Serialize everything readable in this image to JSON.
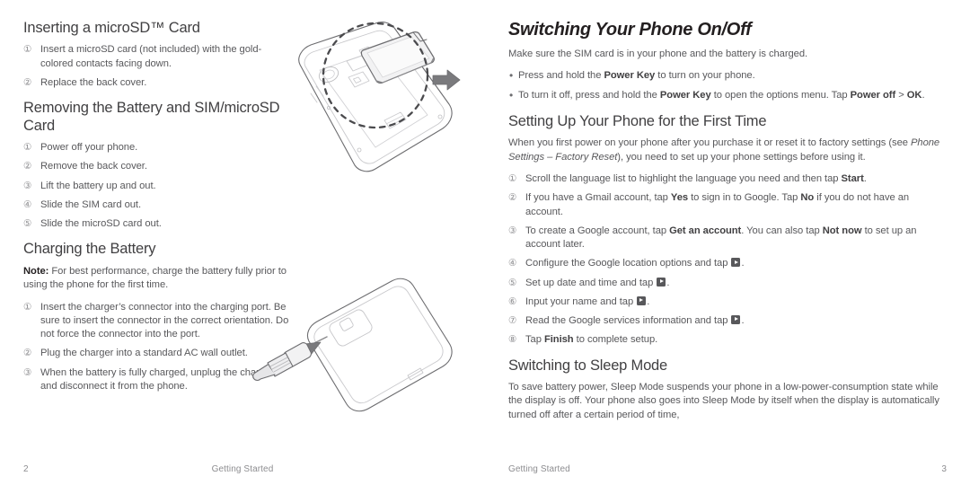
{
  "document": {
    "type": "phone-user-manual-spread",
    "colors": {
      "body_text": "#58585b",
      "heading_text": "#414042",
      "bold_text": "#231f20",
      "footer_text": "#8d8d90",
      "line_art": "#6d6d70",
      "background": "#ffffff"
    }
  },
  "left_page": {
    "sections": [
      {
        "heading": "Inserting a microSD™ Card",
        "steps": [
          "Insert a microSD card (not included) with the gold-colored contacts facing down.",
          "Replace the back cover."
        ]
      },
      {
        "heading": "Removing the Battery and SIM/microSD Card",
        "steps": [
          "Power off your phone.",
          "Remove the back cover.",
          "Lift the battery up and out.",
          "Slide the SIM card out.",
          "Slide the microSD card out."
        ]
      },
      {
        "heading": "Charging the Battery",
        "note_label": "Note:",
        "note_text": " For best performance, charge the battery fully prior to using the phone for the first time.",
        "steps": [
          "Insert the charger’s connector into the charging port. Be sure to insert the connector in the correct orientation. Do not force the connector into the port.",
          "Plug the charger into a standard AC wall outlet.",
          "When the battery is fully charged, unplug the charger and disconnect it from the phone."
        ]
      }
    ],
    "illustrations": [
      {
        "name": "phone-back-with-microsd-card",
        "caption_visible": false
      },
      {
        "name": "phone-with-charger-connector",
        "caption_visible": false
      }
    ],
    "footer": {
      "page_number": "2",
      "label": "Getting Started"
    }
  },
  "right_page": {
    "chapter_title": "Switching Your Phone On/Off",
    "intro": "Make sure the SIM card is in your phone and the battery is charged.",
    "bullets": [
      {
        "pre": "Press and hold the ",
        "bold": "Power Key",
        "post": " to turn on your phone."
      },
      {
        "pre": "To turn it off, press and hold the ",
        "bold": "Power Key",
        "post": " to open the options menu. Tap ",
        "bold2": "Power off",
        "mid2": " > ",
        "bold3": "OK",
        "post2": "."
      }
    ],
    "setup_section": {
      "heading": "Setting Up Your Phone for the First Time",
      "intro_pre": "When you first power on your phone after you purchase it or reset it to factory settings (see ",
      "intro_italic": "Phone Settings – Factory Reset",
      "intro_post": "), you need to set up your phone settings before using it.",
      "steps": [
        {
          "pre": "Scroll the language list to highlight the language you need and then tap ",
          "bold": "Start",
          "post": "."
        },
        {
          "pre": "If you have a Gmail account, tap ",
          "bold": "Yes",
          "mid": " to sign in to Google. Tap ",
          "bold2": "No",
          "post": " if you do not have an account."
        },
        {
          "pre": "To create a Google account, tap ",
          "bold": "Get an account",
          "mid": ". You can also tap ",
          "bold2": "Not now",
          "post": " to set up an account later."
        },
        {
          "pre": "Configure the Google location options and tap ",
          "icon": "next-play-button",
          "post": "."
        },
        {
          "pre": "Set up date and time and tap ",
          "icon": "next-play-button",
          "post": "."
        },
        {
          "pre": "Input your name and tap ",
          "icon": "next-play-button",
          "post": "."
        },
        {
          "pre": "Read the Google services information and tap ",
          "icon": "next-play-button",
          "post": "."
        },
        {
          "pre": "Tap ",
          "bold": "Finish",
          "post": " to complete setup."
        }
      ]
    },
    "sleep_section": {
      "heading": "Switching to Sleep Mode",
      "text": "To save battery power, Sleep Mode suspends your phone in a low-power-consumption state while the display is off. Your phone also goes into Sleep Mode by itself when the display is automatically turned off after a certain period of time,"
    },
    "footer": {
      "label": "Getting Started",
      "page_number": "3"
    }
  }
}
